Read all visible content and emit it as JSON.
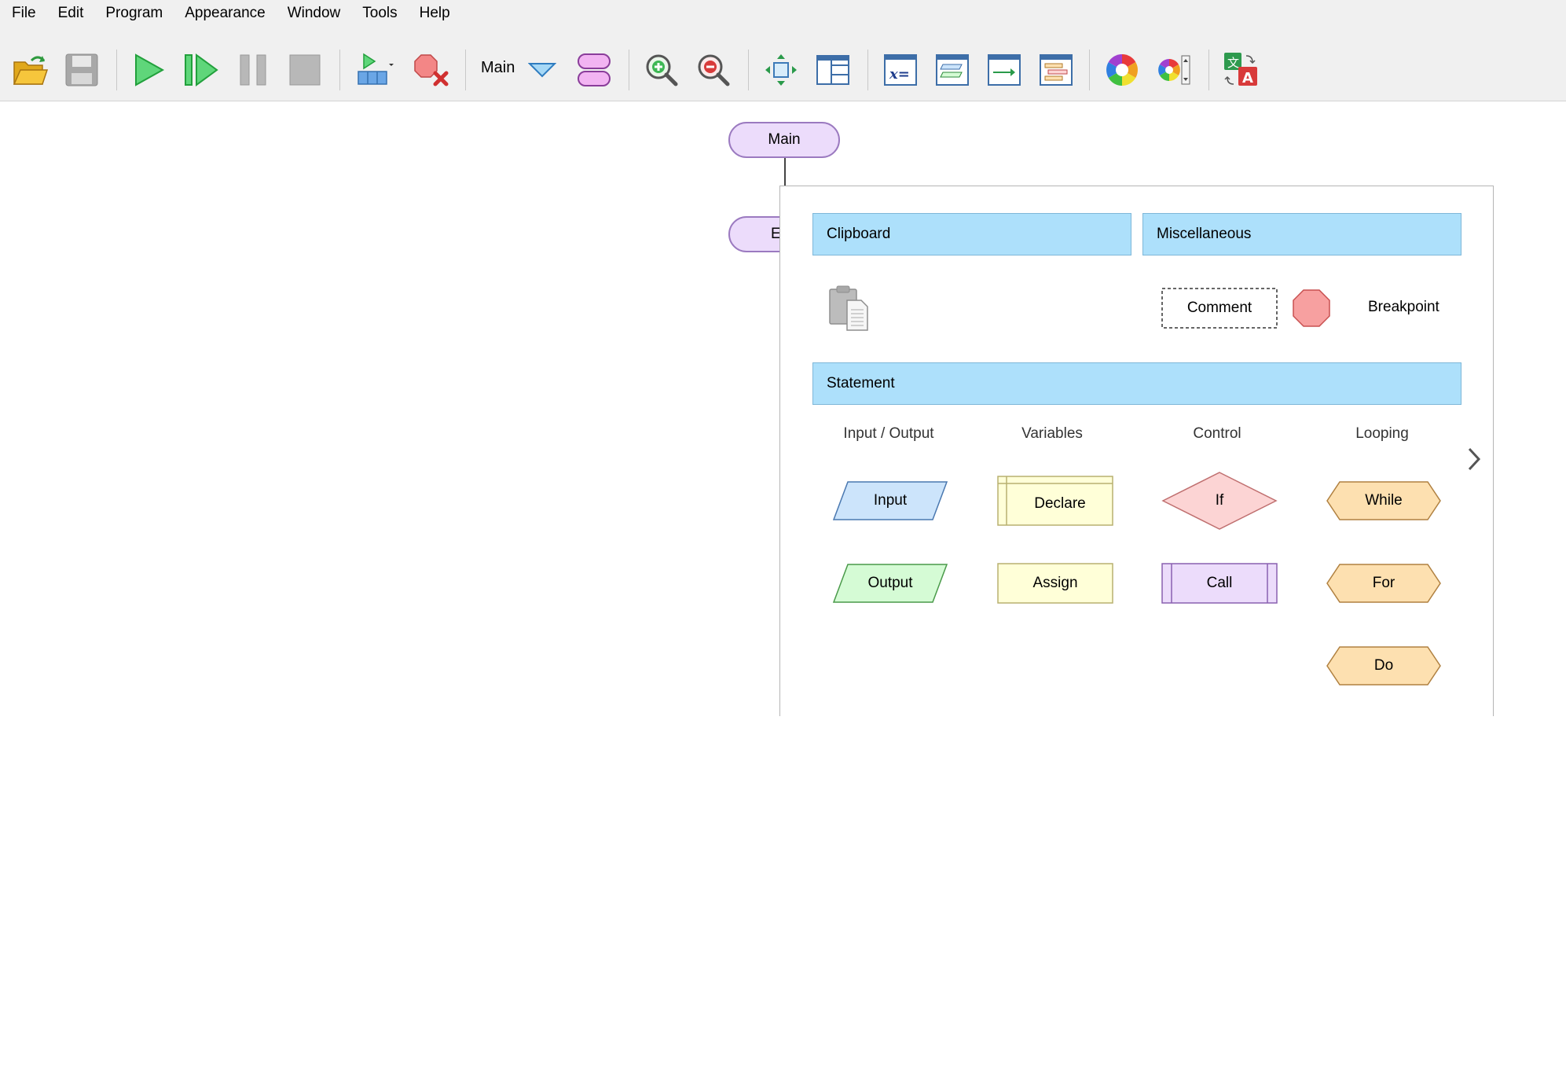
{
  "menu": [
    "File",
    "Edit",
    "Program",
    "Appearance",
    "Window",
    "Tools",
    "Help"
  ],
  "toolbar": {
    "subchart_name": "Main",
    "icons": [
      "open-folder-icon",
      "save-icon",
      "run-icon",
      "step-icon",
      "pause-icon",
      "stop-icon",
      "run-to-icon",
      "clear-breakpoints-icon",
      "subchart-dropdown-icon",
      "add-function-icon",
      "zoom-in-icon",
      "zoom-out-icon",
      "fit-view-icon",
      "layout-icon",
      "variables-window-icon",
      "console-window-icon",
      "output-window-icon",
      "flowchart-window-icon",
      "color-theme-icon",
      "color-select-icon",
      "translate-icon"
    ]
  },
  "canvas": {
    "main_block": "Main",
    "end_block_partial": "E"
  },
  "popup": {
    "clipboard_header": "Clipboard",
    "misc_header": "Miscellaneous",
    "comment_label": "Comment",
    "breakpoint_label": "Breakpoint",
    "statement_header": "Statement",
    "columns": [
      "Input / Output",
      "Variables",
      "Control",
      "Looping"
    ],
    "shapes": {
      "input": "Input",
      "output": "Output",
      "declare": "Declare",
      "assign": "Assign",
      "if": "If",
      "call": "Call",
      "while": "While",
      "for": "For",
      "do": "Do"
    }
  },
  "colors": {
    "header_bg": "#ade0fb",
    "input_fill": "#cce4fb",
    "output_fill": "#d5fbd5",
    "variable_fill": "#ffffd8",
    "control_fill": "#fcd4d4",
    "call_fill": "#ecdcfb",
    "loop_fill": "#fde0b0",
    "terminal_fill": "#ecdcfb"
  }
}
